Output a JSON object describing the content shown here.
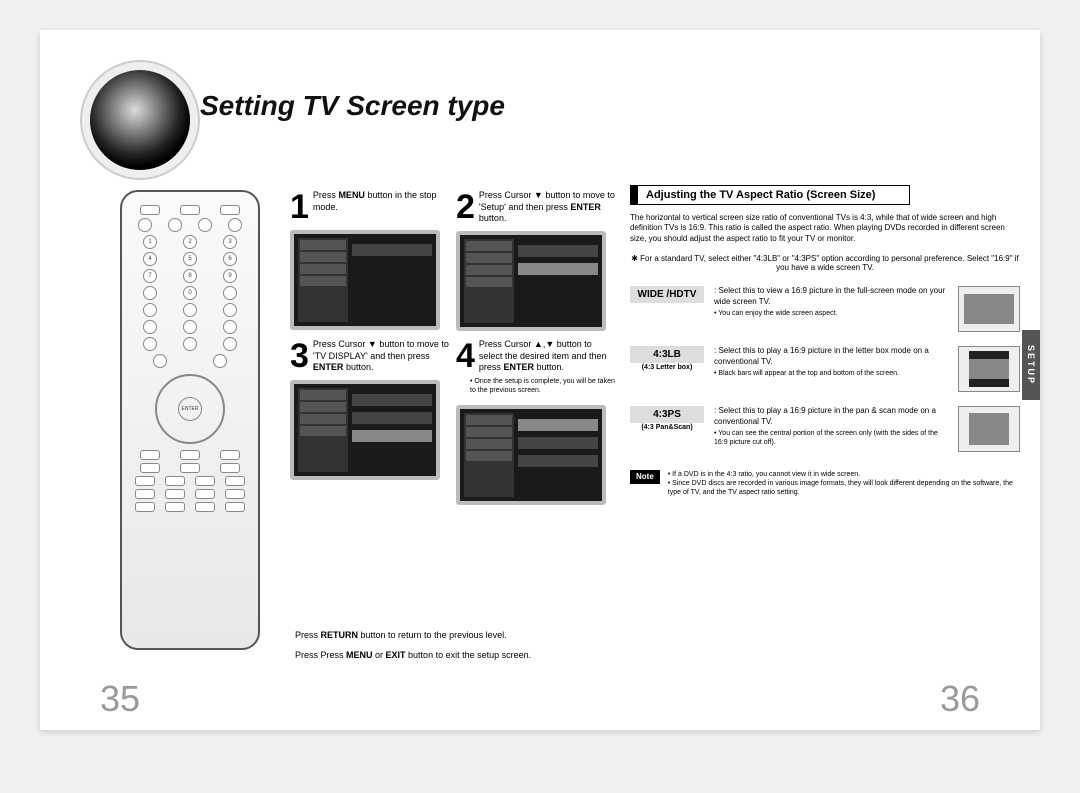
{
  "title": "Setting TV Screen type",
  "side_tab": "SETUP",
  "page_left": "35",
  "page_right": "36",
  "steps": [
    {
      "num": "1",
      "text_pre": "Press ",
      "bold1": "MENU",
      "text_post": " button in the stop mode."
    },
    {
      "num": "2",
      "text_pre": "Press Cursor ▼ button to move to 'Setup' and then press ",
      "bold1": "ENTER",
      "text_post": " button."
    },
    {
      "num": "3",
      "text_pre": "Press Cursor ▼ button to move to 'TV DISPLAY' and then press ",
      "bold1": "ENTER",
      "text_post": " button."
    },
    {
      "num": "4",
      "text_pre": "Press Cursor ▲,▼ button to select the desired item and then press ",
      "bold1": "ENTER",
      "text_post": " button."
    }
  ],
  "fine_print": "• Once the setup is complete, you will be taken to the previous screen.",
  "section_head": "Adjusting the TV Aspect Ratio (Screen Size)",
  "intro": "The horizontal to vertical screen size ratio of conventional TVs is 4:3, while that of wide screen and high definition TVs is 16:9. This ratio is called the aspect ratio. When playing DVDs recorded in different screen size, you should adjust the aspect ratio to fit your TV or monitor.",
  "star_note": "✱ For a standard TV, select either \"4:3LB\" or \"4:3PS\" option according to personal preference. Select \"16:9\" if you have a wide screen TV.",
  "options": [
    {
      "label_big": "WIDE /HDTV",
      "label_small": "",
      "desc": ": Select this to view a 16:9 picture in the full-screen mode on your wide screen TV.",
      "sub": "• You can enjoy the wide screen aspect.",
      "thumb": "wide"
    },
    {
      "label_big": "4:3LB",
      "label_small": "(4:3 Letter box)",
      "desc": ": Select this to play a 16:9 picture in the letter box mode on a conventional TV.",
      "sub": "• Black bars will appear at the top and bottom of the screen.",
      "thumb": "lb"
    },
    {
      "label_big": "4:3PS",
      "label_small": "(4:3 Pan&Scan)",
      "desc": ": Select this to play a 16:9 picture in the pan & scan mode on a conventional TV.",
      "sub": "• You can see the central portion of the screen only (with the sides of the 16:9 picture cut off).",
      "thumb": "ps"
    }
  ],
  "note_tag": "Note",
  "note_lines": "• If a DVD is in the 4:3 ratio, you cannot view it in wide screen.\n• Since DVD discs are recorded in various image formats, they will look different depending on the software, the type of TV, and the TV aspect ratio setting.",
  "footer": [
    {
      "pre": "Press ",
      "b1": "RETURN",
      "post": " button to return to the previous level."
    },
    {
      "pre": "Press Press ",
      "b1": "MENU",
      "mid": " or ",
      "b2": "EXIT",
      "post": " button to exit the setup screen."
    }
  ],
  "remote_enter": "ENTER"
}
